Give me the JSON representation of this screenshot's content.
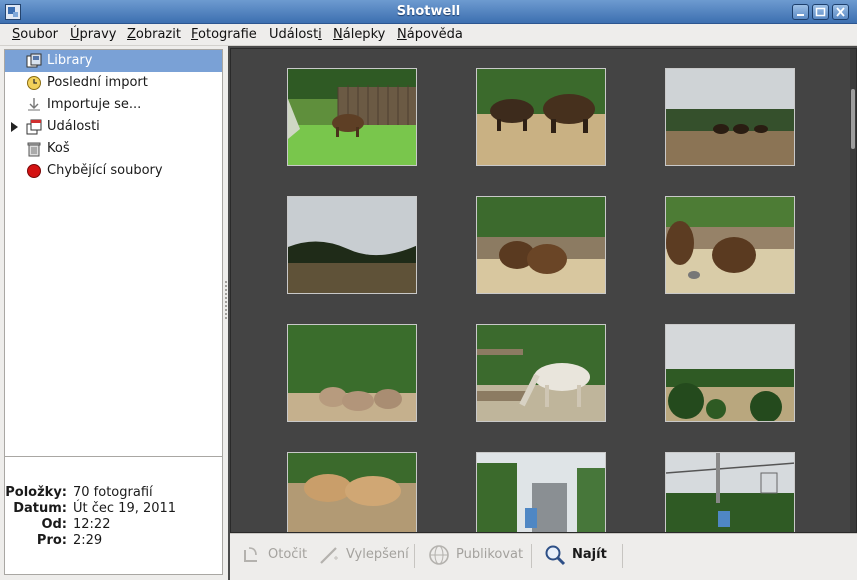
{
  "window": {
    "title": "Shotwell"
  },
  "menu": [
    {
      "text": "Soubor",
      "acc": "S",
      "rest": "oubor"
    },
    {
      "text": "Úpravy",
      "acc": "Ú",
      "rest": "pravy"
    },
    {
      "text": "Zobrazit",
      "acc": "Z",
      "rest": "obrazit"
    },
    {
      "text": "Fotografie",
      "acc": "F",
      "rest": "otografie"
    },
    {
      "text": "Události",
      "pre": "Událost",
      "acc": "i",
      "rest": ""
    },
    {
      "text": "Nálepky",
      "acc": "N",
      "rest": "álepky"
    },
    {
      "text": "Nápověda",
      "acc": "N",
      "rest": "ápověda"
    }
  ],
  "sidebar": {
    "items": [
      {
        "label": "Library",
        "icon": "library-icon",
        "selected": true
      },
      {
        "label": "Poslední import",
        "icon": "clock-icon"
      },
      {
        "label": "Importuje se...",
        "icon": "import-arrow-icon"
      },
      {
        "label": "Události",
        "icon": "events-icon",
        "expandable": true
      },
      {
        "label": "Koš",
        "icon": "trash-icon"
      },
      {
        "label": "Chybějící soubory",
        "icon": "missing-files-icon"
      }
    ]
  },
  "info": {
    "rows": [
      {
        "key": "Položky:",
        "value": "70 fotografií"
      },
      {
        "key": "Datum:",
        "value": "Út čec 19, 2011"
      },
      {
        "key": "Od:",
        "value": "12:22"
      },
      {
        "key": "Pro:",
        "value": "2:29"
      }
    ]
  },
  "toolbar": {
    "rotate": "Otočit",
    "enhance": "Vylepšení",
    "publish": "Publikovat",
    "find": "Najít"
  },
  "colors": {
    "selection": "#7aa1d6",
    "titlebar": "#4a7cbd",
    "viewer_bg": "#444444"
  }
}
